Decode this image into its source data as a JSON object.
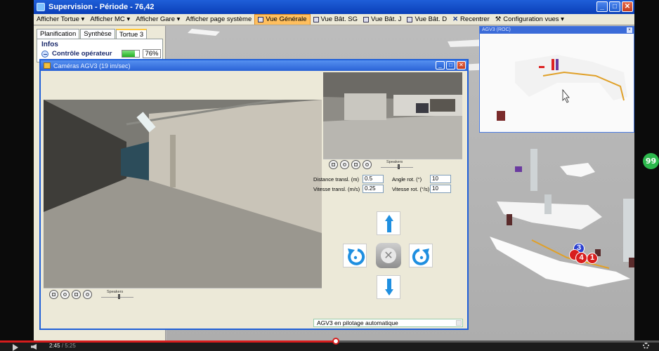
{
  "window": {
    "title": "Supervision - Période - 76,42"
  },
  "menu": [
    {
      "label": "Afficher Tortue",
      "caret": "▾"
    },
    {
      "label": "Afficher MC",
      "caret": "▾"
    },
    {
      "label": "Afficher Gare",
      "caret": "▾"
    },
    {
      "label": "Afficher page système",
      "caret": ""
    },
    {
      "label": "Vue Générale",
      "caret": "",
      "active": true
    },
    {
      "label": "Vue Bât. SG",
      "caret": ""
    },
    {
      "label": "Vue Bât. J",
      "caret": ""
    },
    {
      "label": "Vue Bât. D",
      "caret": ""
    },
    {
      "label": "Recentrer",
      "caret": ""
    },
    {
      "label": "Configuration vues",
      "caret": "▾"
    }
  ],
  "left_panel": {
    "tabs": [
      "Planification",
      "Synthèse",
      "Tortue 3"
    ],
    "active_tab": 2,
    "info_title": "Infos",
    "control_label": "Contrôle opérateur",
    "control_value": "76%",
    "control_fraction": 0.76
  },
  "agv_inset": {
    "title": "AGV3 (ROC)"
  },
  "camera_window": {
    "title": "Caméras AGV3 (19 im/sec)",
    "speakers_label": "Speakers",
    "fields": {
      "dist_label": "Distance transl. (m)",
      "dist_value": "0.5",
      "angle_label": "Angle rot. (°)",
      "angle_value": "10",
      "vtrans_label": "Vitesse transl. (m/s)",
      "vtrans_value": "0.25",
      "vrot_label": "Vitesse rot. (°/s)",
      "vrot_value": "10"
    },
    "status": "AGV3 en pilotage automatique"
  },
  "markers": [
    "3",
    "4",
    "1"
  ],
  "bubble": "99",
  "player": {
    "current_time": "2:45",
    "duration": "/ 5:25",
    "progress_fraction": 0.51
  },
  "colors": {
    "titlebar": "#0a3fb8",
    "menu_active": "#ffbf5e",
    "progress_green": "#21b121",
    "arrow_blue": "#1f8fe0",
    "marker_red": "#d81e1e",
    "marker_blue": "#2a3fd0",
    "player_red": "#d61d1d"
  }
}
